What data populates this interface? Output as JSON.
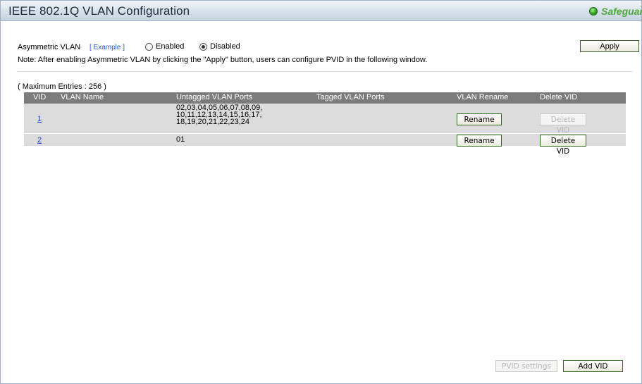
{
  "header": {
    "title": "IEEE 802.1Q VLAN Configuration",
    "safeguard_label": "Safeguard",
    "safeguard_color": "#4fa73c"
  },
  "asymmetric": {
    "label": "Asymmetric VLAN",
    "example_link": "[ Example ]",
    "options": [
      {
        "label": "Enabled",
        "selected": false
      },
      {
        "label": "Disabled",
        "selected": true
      }
    ],
    "apply_label": "Apply",
    "note": "Note: After enabling Asymmetric VLAN by clicking the \"Apply\" button, users can configure PVID in the following window."
  },
  "table": {
    "max_entries": "( Maximum Entries : 256 )",
    "columns": [
      "VID",
      "VLAN Name",
      "Untagged VLAN Ports",
      "Tagged VLAN Ports",
      "VLAN Rename",
      "Delete VID"
    ],
    "rows": [
      {
        "vid": "1",
        "name": "",
        "untagged": [
          "02,03,04,05,06,07,08,09,",
          "10,11,12,13,14,15,16,17,",
          "18,19,20,21,22,23,24"
        ],
        "tagged": "",
        "rename_label": "Rename",
        "delete_label": "Delete VID",
        "delete_enabled": false
      },
      {
        "vid": "2",
        "name": "",
        "untagged": [
          "01"
        ],
        "tagged": "",
        "rename_label": "Rename",
        "delete_label": "Delete VID",
        "delete_enabled": true
      }
    ]
  },
  "footer": {
    "pvid_settings_label": "PVID settings",
    "add_vid_label": "Add VID"
  }
}
